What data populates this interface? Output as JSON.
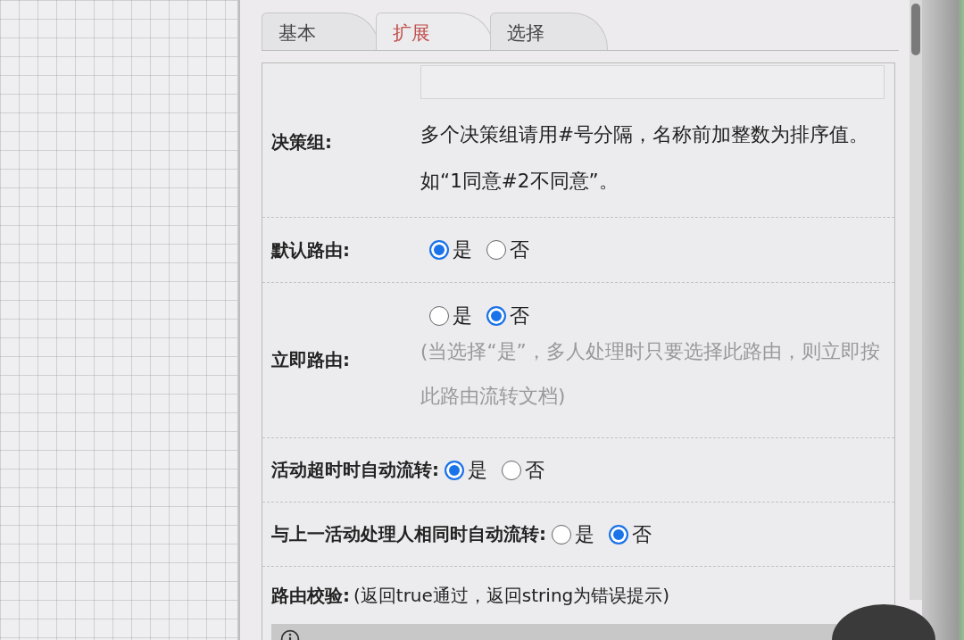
{
  "tabs": [
    {
      "label": "基本",
      "selected": false
    },
    {
      "label": "扩展",
      "selected": true
    },
    {
      "label": "选择",
      "selected": false
    }
  ],
  "fields": [
    {
      "kind": "text",
      "label": "决策组:",
      "help": "多个决策组请用#号分隔，名称前加整数为排序值。如“1同意#2不同意”。"
    },
    {
      "kind": "radio",
      "label": "默认路由:",
      "options": [
        {
          "label": "是",
          "selected": true
        },
        {
          "label": "否",
          "selected": false
        }
      ]
    },
    {
      "kind": "radio",
      "label": "立即路由:",
      "hint": "(当选择“是”，多人处理时只要选择此路由，则立即按此路由流转文档)",
      "options": [
        {
          "label": "是",
          "selected": false
        },
        {
          "label": "否",
          "selected": true
        }
      ]
    },
    {
      "kind": "radio_inline",
      "label": "活动超时时自动流转:",
      "options": [
        {
          "label": "是",
          "selected": true
        },
        {
          "label": "否",
          "selected": false
        }
      ]
    },
    {
      "kind": "radio_inline",
      "label": "与上一活动处理人相同时自动流转:",
      "options": [
        {
          "label": "是",
          "selected": false
        },
        {
          "label": "否",
          "selected": true
        }
      ]
    },
    {
      "kind": "code",
      "label": "路由校验:",
      "hint": "(返回true通过，返回string为错误提示)"
    }
  ]
}
